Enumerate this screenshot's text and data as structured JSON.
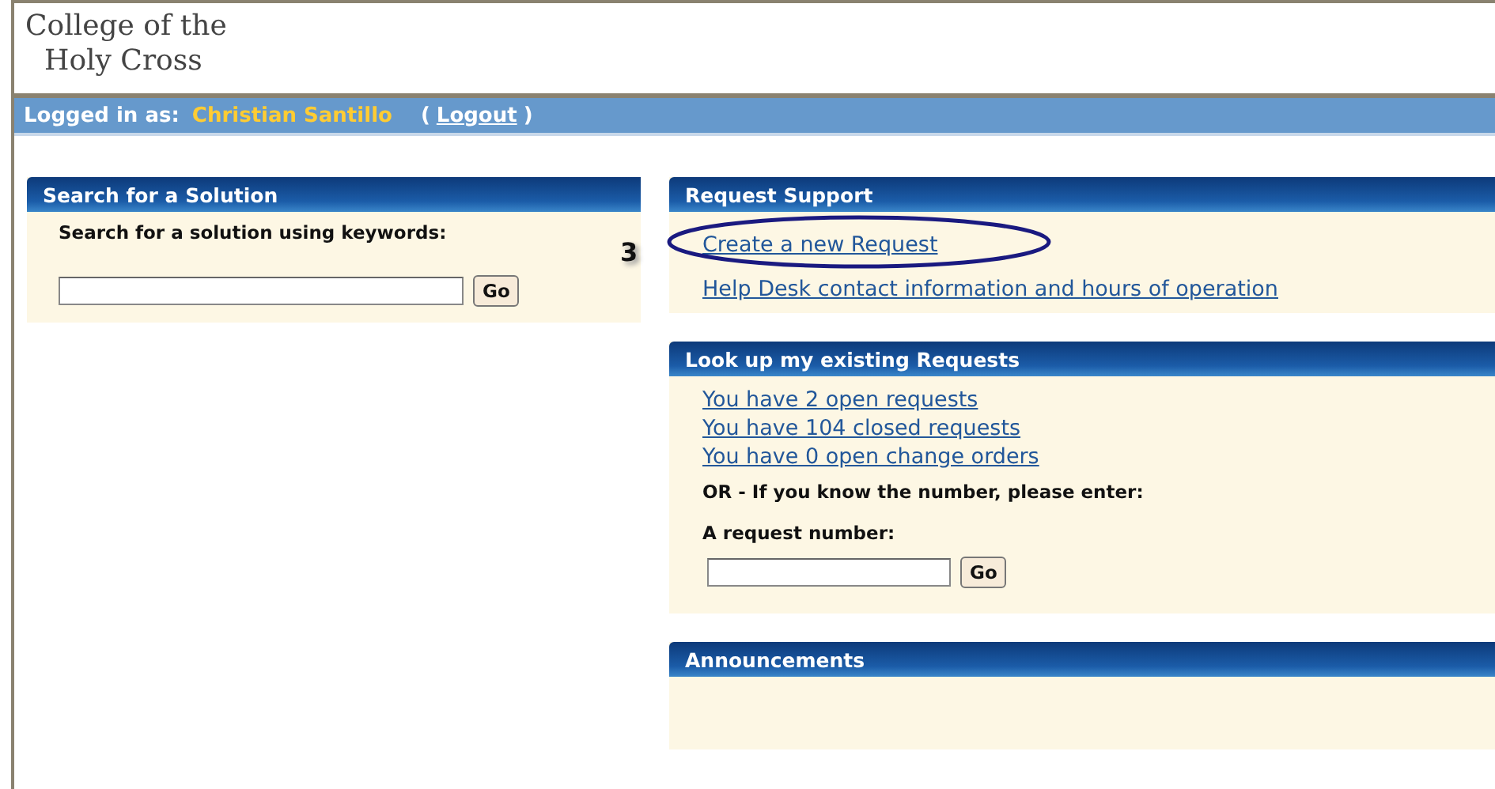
{
  "header": {
    "logo_lines": [
      "College of the",
      "Holy Cross"
    ]
  },
  "user_bar": {
    "label": "Logged in as:",
    "user": "Christian Santillo",
    "logout_open": "(",
    "logout": "Logout",
    "logout_close": ")"
  },
  "search_panel": {
    "title": "Search for a Solution",
    "prompt": "Search for a solution using keywords:",
    "button": "Go"
  },
  "annotation": {
    "number": "3"
  },
  "request_panel": {
    "title": "Request Support",
    "links": [
      {
        "text": "Create a new Request",
        "circled": true
      },
      {
        "text": "Help Desk contact information and hours of operation",
        "circled": false
      }
    ]
  },
  "lookup_panel": {
    "title": "Look up my existing Requests",
    "links": [
      "You have 2 open requests",
      "You have 104 closed requests",
      "You have 0 open change orders"
    ],
    "hint": "OR - If you know the number, please enter:",
    "field_label": "A request number:",
    "button": "Go"
  },
  "announcements_panel": {
    "title": "Announcements"
  }
}
